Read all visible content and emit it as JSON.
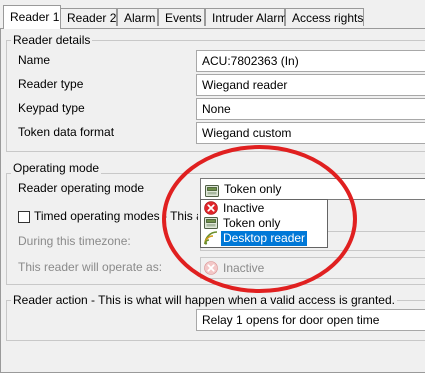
{
  "tabs": [
    {
      "label": "Reader 1",
      "active": true
    },
    {
      "label": "Reader 2"
    },
    {
      "label": "Alarm"
    },
    {
      "label": "Events"
    },
    {
      "label": "Intruder Alarm"
    },
    {
      "label": "Access rights"
    }
  ],
  "reader_details": {
    "legend": "Reader details",
    "rows": [
      {
        "label": "Name",
        "value": "ACU:7802363 (In)"
      },
      {
        "label": "Reader type",
        "value": "Wiegand reader"
      },
      {
        "label": "Keypad type",
        "value": "None"
      },
      {
        "label": "Token data format",
        "value": "Wiegand custom"
      }
    ]
  },
  "operating_mode": {
    "legend": "Operating mode",
    "mode_label": "Reader operating mode",
    "mode_value": "Token only",
    "timed_label": "Timed operating modes - This allow",
    "timezone_label": "During this timezone:",
    "operate_label": "This reader will operate as:",
    "operate_value": "Inactive",
    "dropdown_options": [
      {
        "label": "Inactive",
        "icon": "inactive-icon"
      },
      {
        "label": "Token only",
        "icon": "token-reader-icon"
      },
      {
        "label": "Desktop reader",
        "icon": "desktop-reader-icon",
        "selected": true
      }
    ]
  },
  "reader_action": {
    "legend": "Reader action - This is what will happen when a valid access is granted.",
    "value": "Relay 1 opens for door open time"
  },
  "colors": {
    "selection": "#0078d7",
    "annotation": "#e02020",
    "inactive_red": "#e0242a"
  }
}
